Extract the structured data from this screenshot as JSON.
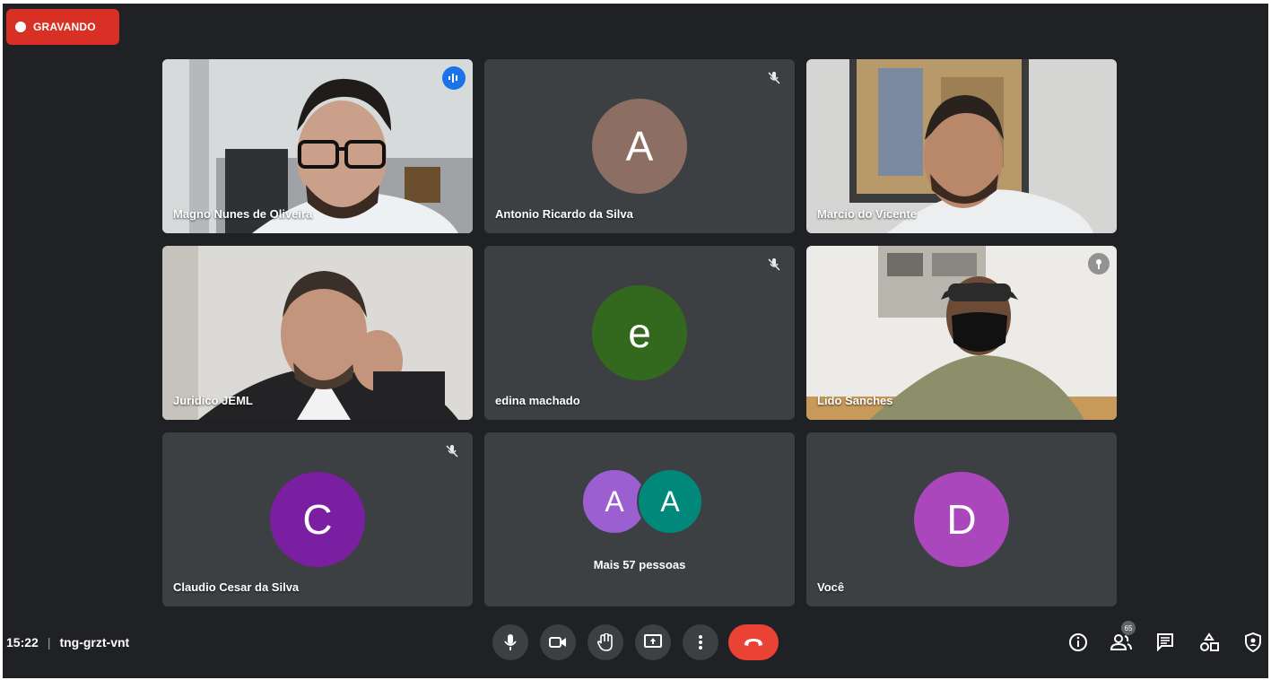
{
  "recording": {
    "label": "GRAVANDO",
    "color": "#d93025"
  },
  "participants": [
    {
      "name": "Magno Nunes de Oliveira",
      "type": "video",
      "speaking": true
    },
    {
      "name": "Antonio Ricardo da Silva",
      "type": "avatar",
      "initial": "A",
      "color": "#8d6e63",
      "muted": true
    },
    {
      "name": "Marcio do Vicente",
      "type": "video"
    },
    {
      "name": "Juridico JEML",
      "type": "video"
    },
    {
      "name": "edina machado",
      "type": "avatar",
      "initial": "e",
      "color": "#33691e",
      "muted": true
    },
    {
      "name": "Lido Sanches",
      "type": "video"
    },
    {
      "name": "Claudio Cesar da Silva",
      "type": "avatar",
      "initial": "C",
      "color": "#7b1fa2",
      "muted": true
    },
    {
      "name": "Você",
      "type": "avatar",
      "initial": "D",
      "color": "#ab47bc"
    }
  ],
  "more_people": {
    "label": "Mais 57 pessoas",
    "avatars": [
      {
        "initial": "A",
        "color": "#9c5fd1"
      },
      {
        "initial": "A",
        "color": "#00897b"
      }
    ]
  },
  "meeting": {
    "time": "15:22",
    "separator": "|",
    "code": "tng-grzt-vnt"
  },
  "controls": {
    "mic": "microphone-icon",
    "camera": "camera-icon",
    "hand": "raise-hand-icon",
    "present": "present-screen-icon",
    "more": "more-options-icon",
    "end": "end-call-icon",
    "end_color": "#ea4335"
  },
  "right_controls": {
    "participants_count": "65"
  }
}
